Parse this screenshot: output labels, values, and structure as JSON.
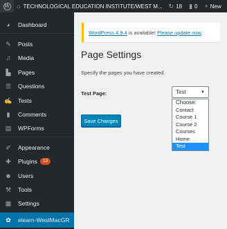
{
  "admin_bar": {
    "site_name": "TECHNOLOGICAL EDUCATION INSTITUTE/WEST M...",
    "updates_count": "18",
    "comments_count": "0",
    "new_label": "New"
  },
  "sidebar": {
    "items": [
      {
        "label": "Dashboard",
        "icon": "dashboard-icon"
      },
      {
        "label": "Posts",
        "icon": "pin-icon"
      },
      {
        "label": "Media",
        "icon": "media-icon"
      },
      {
        "label": "Pages",
        "icon": "pages-icon"
      },
      {
        "label": "Questions",
        "icon": "list-icon"
      },
      {
        "label": "Tests",
        "icon": "edit-icon"
      },
      {
        "label": "Comments",
        "icon": "comment-icon"
      },
      {
        "label": "WPForms",
        "icon": "forms-icon"
      },
      {
        "label": "Appearance",
        "icon": "brush-icon"
      },
      {
        "label": "Plugins",
        "icon": "plugin-icon",
        "badge": "13"
      },
      {
        "label": "Users",
        "icon": "user-icon"
      },
      {
        "label": "Tools",
        "icon": "wrench-icon"
      },
      {
        "label": "Settings",
        "icon": "settings-icon"
      },
      {
        "label": "elearn-WestMacGR",
        "icon": "gear-icon",
        "active": true
      }
    ]
  },
  "notice": {
    "version_link": "WordPress 4.9.4",
    "text": " is available! ",
    "update_link": "Please update now",
    "end": "."
  },
  "page": {
    "title": "Page Settings",
    "description": "Specify the pages you have created.",
    "field_label": "Test Page:",
    "selected_value": "Test",
    "options": [
      "Choose:",
      "Contact",
      "Course 1",
      "Course 2",
      "Courses",
      "Home",
      "Test"
    ],
    "save_label": "Save Changes"
  },
  "colors": {
    "admin_dark": "#23282d",
    "accent_blue": "#0073aa",
    "notice_yellow": "#ffb900",
    "badge_orange": "#d54e21",
    "highlight_blue": "#1e90ff"
  }
}
